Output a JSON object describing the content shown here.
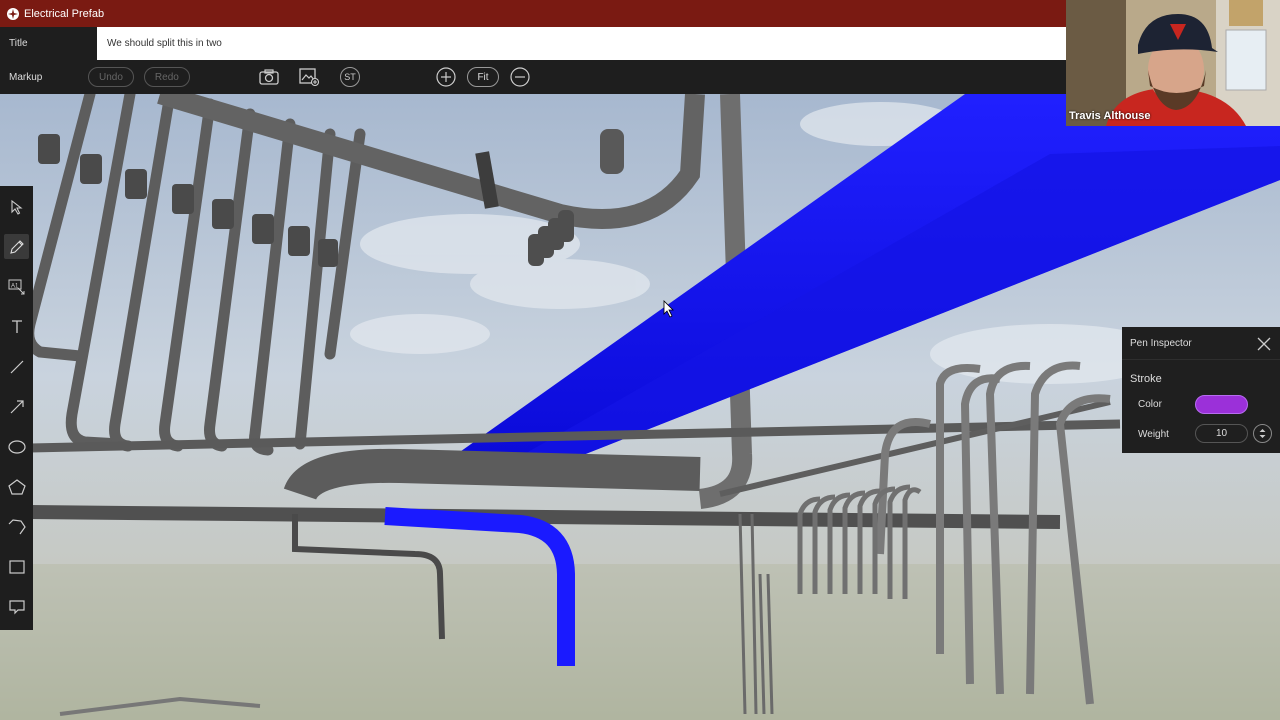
{
  "app": {
    "title": "Electrical Prefab"
  },
  "title_row": {
    "label": "Title",
    "value": "We should split this in two"
  },
  "markup_bar": {
    "label": "Markup",
    "undo_label": "Undo",
    "redo_label": "Redo",
    "st_label": "ST",
    "fit_label": "Fit",
    "icons": [
      "camera-icon",
      "image-add-icon",
      "zoom-in-icon",
      "zoom-out-icon"
    ]
  },
  "tools": [
    "select-arrow-icon",
    "pen-icon",
    "stamp-label-icon",
    "text-icon",
    "line-icon",
    "arrow-icon",
    "ellipse-icon",
    "polygon-icon",
    "polyline-icon",
    "rectangle-icon",
    "comment-icon"
  ],
  "active_tool": "pen-icon",
  "webcam": {
    "name": "Travis Althouse"
  },
  "pen_inspector": {
    "title": "Pen Inspector",
    "section": "Stroke",
    "color_label": "Color",
    "color_value": "#9b30d9",
    "weight_label": "Weight",
    "weight_value": "10"
  },
  "colors": {
    "title_bar": "#7a1a12",
    "selection_blue": "#1010f0",
    "conduit_gray": "#6a6a6a"
  }
}
